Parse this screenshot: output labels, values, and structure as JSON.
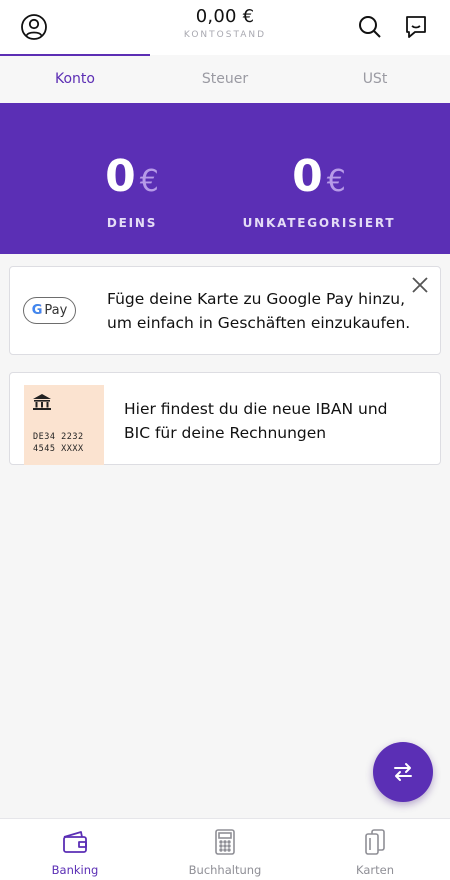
{
  "header": {
    "balance_amount": "0,00 €",
    "balance_label": "KONTOSTAND",
    "profile_icon": "user-circle-icon",
    "search_icon": "search-icon",
    "chat_icon": "chat-bubble-icon"
  },
  "tabs": [
    {
      "label": "Konto",
      "active": true
    },
    {
      "label": "Steuer",
      "active": false
    },
    {
      "label": "USt",
      "active": false
    }
  ],
  "hero": {
    "stats": [
      {
        "value": "0",
        "currency": "€",
        "label": "DEINS"
      },
      {
        "value": "0",
        "currency": "€",
        "label": "UNKATEGORISIERT"
      }
    ]
  },
  "gpay_card": {
    "badge_g": "G",
    "badge_pay": "Pay",
    "line1": "Füge deine Karte zu Google Pay hinzu,",
    "line2": "um einfach in Geschäften einzukaufen."
  },
  "iban_card": {
    "thumb_line1": "DE34  2232",
    "thumb_line2": "4545  XXXX",
    "line1": "Hier findest du die neue IBAN und",
    "line2": "BIC für deine Rechnungen"
  },
  "bottom_nav": [
    {
      "label": "Banking",
      "icon": "wallet-icon",
      "active": true
    },
    {
      "label": "Buchhaltung",
      "icon": "calculator-icon",
      "active": false
    },
    {
      "label": "Karten",
      "icon": "cards-icon",
      "active": false
    }
  ],
  "colors": {
    "brand_purple": "#5b2fb5",
    "accent_light": "#b79be8",
    "card_thumb": "#fbe3d0"
  }
}
